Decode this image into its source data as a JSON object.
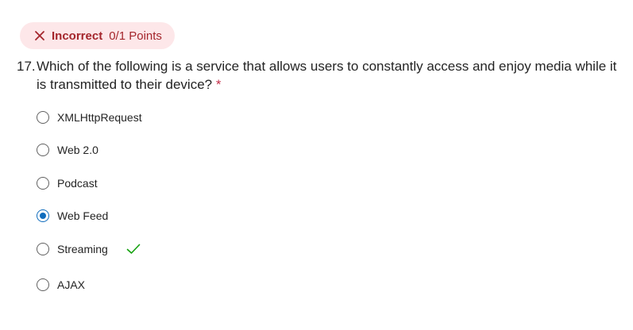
{
  "result": {
    "status": "Incorrect",
    "points": "0/1 Points",
    "icon": "close-icon",
    "color": "#a4262c",
    "background": "#fde7e9"
  },
  "question": {
    "number": "17.",
    "text": "Which of the following is a service that allows users to constantly access and enjoy media while it is transmitted to their device?",
    "required_marker": "*"
  },
  "options": [
    {
      "label": "XMLHttpRequest",
      "selected": false,
      "correct": false
    },
    {
      "label": "Web 2.0",
      "selected": false,
      "correct": false
    },
    {
      "label": "Podcast",
      "selected": false,
      "correct": false
    },
    {
      "label": "Web Feed",
      "selected": true,
      "correct": false
    },
    {
      "label": "Streaming",
      "selected": false,
      "correct": true
    },
    {
      "label": "AJAX",
      "selected": false,
      "correct": false
    }
  ],
  "colors": {
    "selected_radio": "#0f6cbd",
    "correct_check": "#13a10e"
  }
}
